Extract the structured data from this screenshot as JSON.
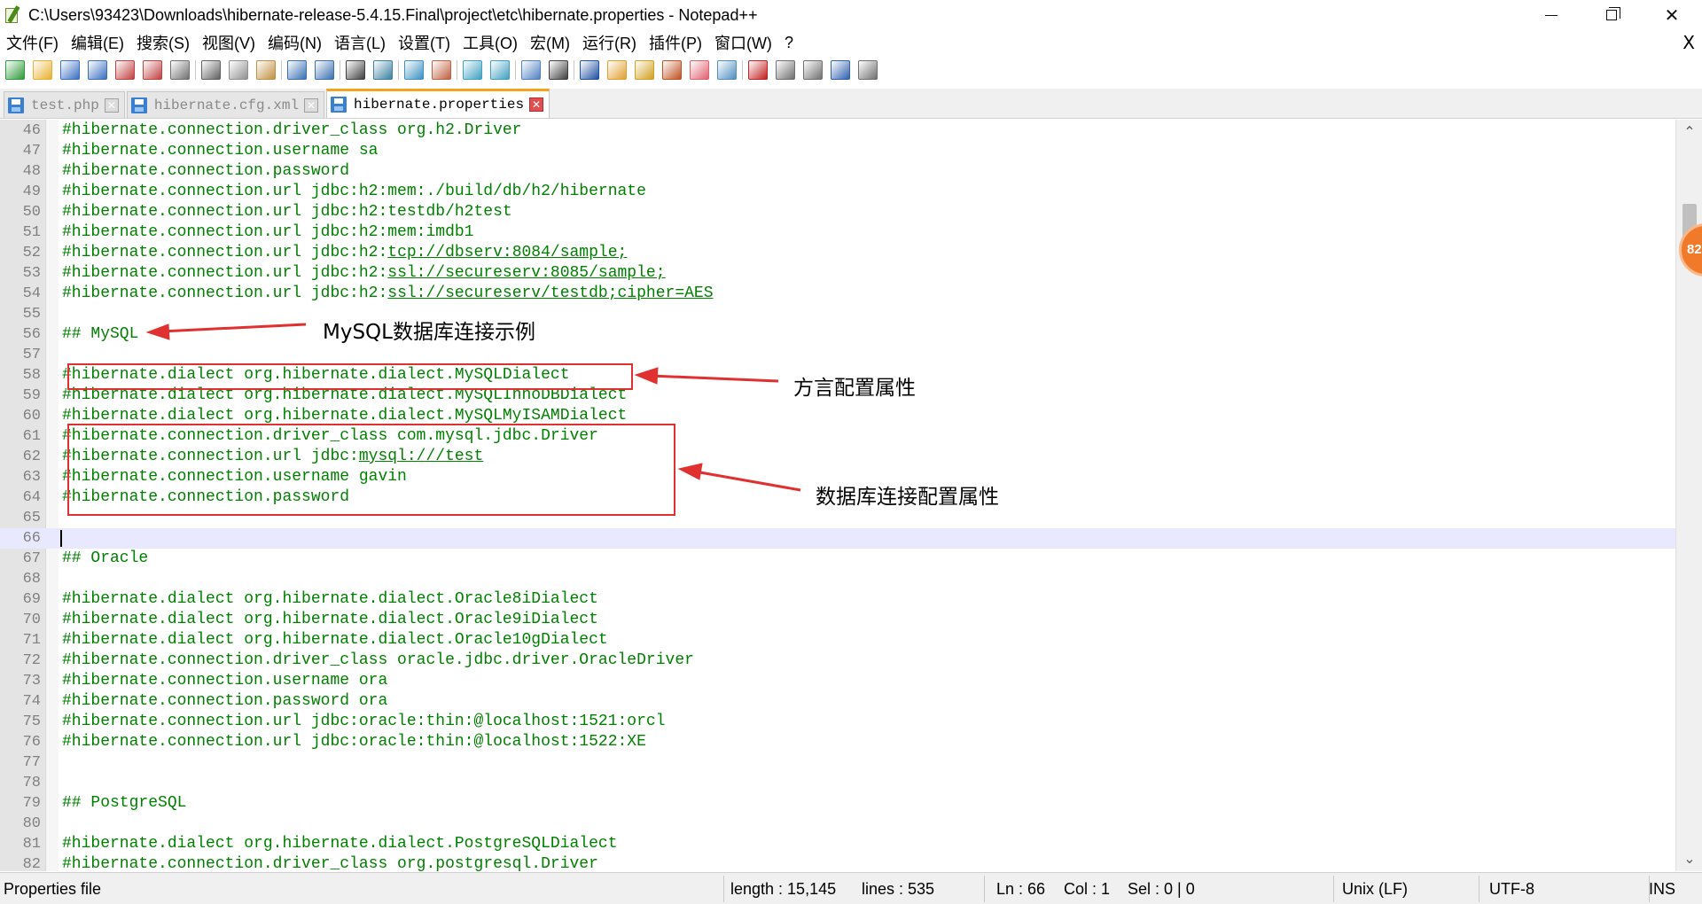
{
  "window": {
    "title": "C:\\Users\\93423\\Downloads\\hibernate-release-5.4.15.Final\\project\\etc\\hibernate.properties - Notepad++",
    "minimize": "",
    "maximize": "",
    "close": "✕"
  },
  "menu": {
    "items": [
      "文件(F)",
      "编辑(E)",
      "搜索(S)",
      "视图(V)",
      "编码(N)",
      "语言(L)",
      "设置(T)",
      "工具(O)",
      "宏(M)",
      "运行(R)",
      "插件(P)",
      "窗口(W)",
      "?"
    ],
    "close_label": "X"
  },
  "toolbar": {
    "icons": [
      "new-file-icon",
      "open-file-icon",
      "save-icon",
      "save-all-icon",
      "close-icon",
      "close-all-icon",
      "print-icon",
      "cut-icon",
      "copy-icon",
      "paste-icon",
      "undo-icon",
      "redo-icon",
      "find-icon",
      "replace-icon",
      "zoom-in-icon",
      "zoom-out-icon",
      "sync-vertical-icon",
      "sync-horizontal-icon",
      "word-wrap-icon",
      "show-all-chars-icon",
      "indent-guide-icon",
      "document-map-icon",
      "function-list-icon",
      "folder-workspace-icon",
      "doc-switcher-icon",
      "monitoring-icon",
      "record-macro-icon",
      "stop-macro-icon",
      "play-macro-icon",
      "run-macro-multiple-icon",
      "save-macro-icon"
    ],
    "colors": [
      "#2f9a3a",
      "#e8b030",
      "#3a6fc0",
      "#3a6fc0",
      "#c04040",
      "#c04040",
      "#707070",
      "#606060",
      "#909090",
      "#c09040",
      "#3a70b0",
      "#3a70b0",
      "#404040",
      "#3a80a0",
      "#3a90c0",
      "#c06040",
      "#40a0c0",
      "#40a0c0",
      "#5080c0",
      "#404040",
      "#2050a0",
      "#e0a030",
      "#d0a020",
      "#c05020",
      "#e06070",
      "#5090c0",
      "#c02020",
      "#707070",
      "#707070",
      "#3060b0",
      "#707070"
    ]
  },
  "tabs": [
    {
      "label": "test.php",
      "active": false
    },
    {
      "label": "hibernate.cfg.xml",
      "active": false
    },
    {
      "label": "hibernate.properties",
      "active": true
    }
  ],
  "editor": {
    "current_line": 66,
    "lines": [
      {
        "n": "46",
        "t": "#hibernate.connection.driver_class org.h2.Driver"
      },
      {
        "n": "47",
        "t": "#hibernate.connection.username sa"
      },
      {
        "n": "48",
        "t": "#hibernate.connection.password"
      },
      {
        "n": "49",
        "t": "#hibernate.connection.url jdbc:h2:mem:./build/db/h2/hibernate"
      },
      {
        "n": "50",
        "t": "#hibernate.connection.url jdbc:h2:testdb/h2test"
      },
      {
        "n": "51",
        "t": "#hibernate.connection.url jdbc:h2:mem:imdb1"
      },
      {
        "n": "52",
        "t": "#hibernate.connection.url jdbc:h2:",
        "u": "tcp://dbserv:8084/sample;"
      },
      {
        "n": "53",
        "t": "#hibernate.connection.url jdbc:h2:",
        "u": "ssl://secureserv:8085/sample;"
      },
      {
        "n": "54",
        "t": "#hibernate.connection.url jdbc:h2:",
        "u": "ssl://secureserv/testdb;cipher=AES"
      },
      {
        "n": "55",
        "t": ""
      },
      {
        "n": "56",
        "t": "## MySQL"
      },
      {
        "n": "57",
        "t": ""
      },
      {
        "n": "58",
        "t": "#hibernate.dialect org.hibernate.dialect.MySQLDialect"
      },
      {
        "n": "59",
        "t": "#hibernate.dialect org.hibernate.dialect.MySQLInnoDBDialect"
      },
      {
        "n": "60",
        "t": "#hibernate.dialect org.hibernate.dialect.MySQLMyISAMDialect"
      },
      {
        "n": "61",
        "t": "#hibernate.connection.driver_class com.mysql.jdbc.Driver"
      },
      {
        "n": "62",
        "t": "#hibernate.connection.url jdbc:",
        "u": "mysql:///test"
      },
      {
        "n": "63",
        "t": "#hibernate.connection.username gavin"
      },
      {
        "n": "64",
        "t": "#hibernate.connection.password"
      },
      {
        "n": "65",
        "t": ""
      },
      {
        "n": "66",
        "t": ""
      },
      {
        "n": "67",
        "t": "## Oracle"
      },
      {
        "n": "68",
        "t": ""
      },
      {
        "n": "69",
        "t": "#hibernate.dialect org.hibernate.dialect.Oracle8iDialect"
      },
      {
        "n": "70",
        "t": "#hibernate.dialect org.hibernate.dialect.Oracle9iDialect"
      },
      {
        "n": "71",
        "t": "#hibernate.dialect org.hibernate.dialect.Oracle10gDialect"
      },
      {
        "n": "72",
        "t": "#hibernate.connection.driver_class oracle.jdbc.driver.OracleDriver"
      },
      {
        "n": "73",
        "t": "#hibernate.connection.username ora"
      },
      {
        "n": "74",
        "t": "#hibernate.connection.password ora"
      },
      {
        "n": "75",
        "t": "#hibernate.connection.url jdbc:oracle:thin:@localhost:1521:orcl"
      },
      {
        "n": "76",
        "t": "#hibernate.connection.url jdbc:oracle:thin:@localhost:1522:XE"
      },
      {
        "n": "77",
        "t": ""
      },
      {
        "n": "78",
        "t": ""
      },
      {
        "n": "79",
        "t": "## PostgreSQL"
      },
      {
        "n": "80",
        "t": ""
      },
      {
        "n": "81",
        "t": "#hibernate.dialect org.hibernate.dialect.PostgreSQLDialect"
      },
      {
        "n": "82",
        "t": "#hibernate.connection.driver_class org.postgresql.Driver"
      }
    ]
  },
  "annotations": {
    "mysql_label": "MySQL数据库连接示例",
    "dialect_label": "方言配置属性",
    "connection_label": "数据库连接配置属性",
    "color": "#e03030"
  },
  "scrollbar": {
    "up_arrow": "⌃",
    "down_arrow": "⌄"
  },
  "badge": {
    "text": "82"
  },
  "status": {
    "file_type": "Properties file",
    "length": "length : 15,145",
    "lines": "lines : 535",
    "ln": "Ln : 66",
    "col": "Col : 1",
    "sel": "Sel : 0 | 0",
    "eol": "Unix (LF)",
    "encoding": "UTF-8",
    "mode": "INS"
  }
}
